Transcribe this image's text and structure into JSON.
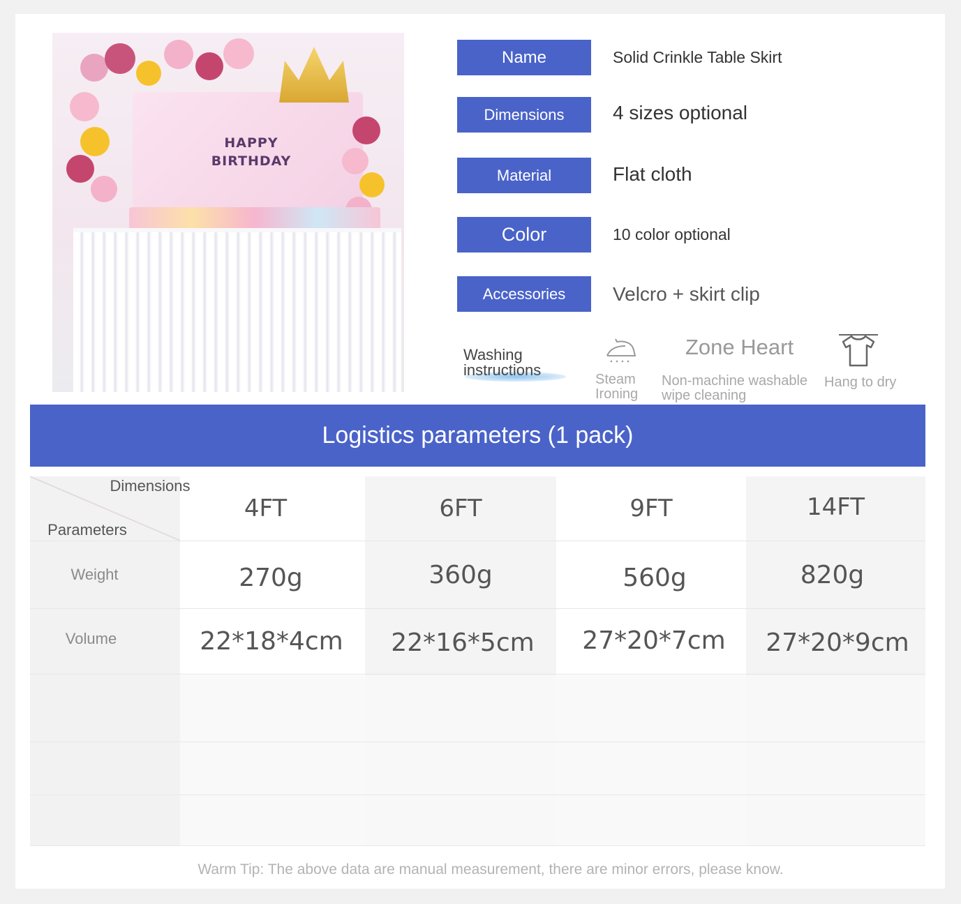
{
  "photo": {
    "banner_line1": "HAPPY",
    "banner_line2": "BIRTHDAY"
  },
  "specs": [
    {
      "label": "Name",
      "value": "Solid Crinkle Table Skirt"
    },
    {
      "label": "Dimensions",
      "value": "4 sizes optional"
    },
    {
      "label": "Material",
      "value": "Flat cloth"
    },
    {
      "label": "Color",
      "value": "10 color optional"
    },
    {
      "label": "Accessories",
      "value": "Velcro + skirt clip"
    }
  ],
  "washing": {
    "title_line1": "Washing",
    "title_line2": "instructions",
    "steam_line1": "Steam",
    "steam_line2": "Ironing",
    "zone_heart": "Zone Heart",
    "nonmachine_line1": "Non-machine washable",
    "nonmachine_line2": "wipe cleaning",
    "hang": "Hang to dry",
    "icons": [
      "iron-icon",
      "shirt-hanger-icon"
    ]
  },
  "logistics": {
    "title": "Logistics parameters (1 pack)",
    "corner_top": "Dimensions",
    "corner_bottom": "Parameters",
    "columns": [
      "4FT",
      "6FT",
      "9FT",
      "14FT"
    ],
    "rows": [
      {
        "label": "Weight",
        "values": [
          "270g",
          "360g",
          "560g",
          "820g"
        ]
      },
      {
        "label": "Volume",
        "values": [
          "22*18*4cm",
          "22*16*5cm",
          "27*20*7cm",
          "27*20*9cm"
        ]
      }
    ]
  },
  "warm_tip": "Warm Tip: The above data are manual measurement, there are minor errors, please know.",
  "colors": {
    "accent_blue": "#4a63c9",
    "cell_grey": "#f3f3f3",
    "cell_white": "#ffffff"
  }
}
